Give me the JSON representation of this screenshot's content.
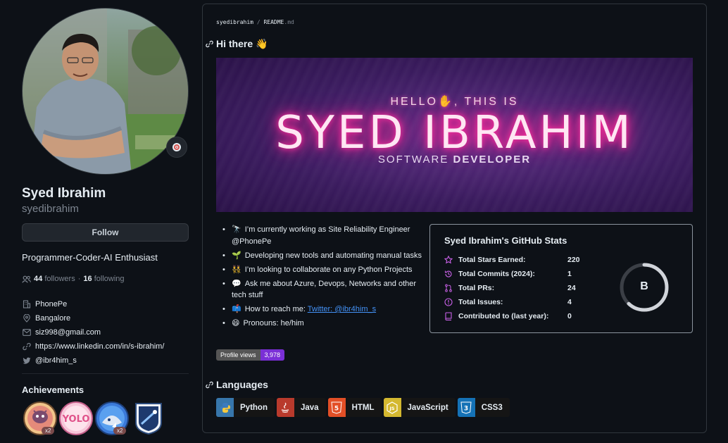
{
  "profile": {
    "name": "Syed Ibrahim",
    "login": "syedibrahim",
    "follow_label": "Follow",
    "bio": "Programmer-Coder-AI Enthusiast",
    "followers_count": "44",
    "followers_label": "followers",
    "separator": "·",
    "following_count": "16",
    "following_label": "following",
    "vcard": [
      {
        "icon": "organization-icon",
        "text": "PhonePe"
      },
      {
        "icon": "location-icon",
        "text": "Bangalore"
      },
      {
        "icon": "mail-icon",
        "text": "siz998@gmail.com"
      },
      {
        "icon": "link-icon",
        "text": "https://www.linkedin.com/in/s-ibrahim/"
      },
      {
        "icon": "twitter-icon",
        "text": "@ibr4him_s"
      }
    ],
    "achievements_title": "Achievements",
    "achievement_counts": [
      "x2",
      "x2"
    ]
  },
  "readme": {
    "breadcrumb_user": "syedibrahim",
    "breadcrumb_sep": "/",
    "breadcrumb_file": "README",
    "breadcrumb_ext": ".md",
    "heading_hi": "Hi there 👋",
    "banner": {
      "hello": "HELLO✋, THIS IS",
      "name": "SYED IBRAHIM",
      "role_a": "SOFTWARE ",
      "role_b": "DEVELOPER"
    },
    "bullets": [
      {
        "emoji": "🔭",
        "text": "I’m currently working as Site Reliability Engineer @PhonePe"
      },
      {
        "emoji": "🌱",
        "text": "Developing new tools and automating manual tasks"
      },
      {
        "emoji": "👯",
        "text": "I’m looking to collaborate on any Python Projects"
      },
      {
        "emoji": "💬",
        "text": "Ask me about Azure, Devops, Networks and other tech stuff"
      },
      {
        "emoji": "📫",
        "text": "How to reach me: ",
        "link": "Twitter: @ibr4him_s"
      },
      {
        "emoji": "😄",
        "text": "Pronouns: he/him"
      }
    ],
    "profile_views_label": "Profile views",
    "profile_views_value": "3,978",
    "stats": {
      "title": "Syed Ibrahim's GitHub Stats",
      "rows": [
        {
          "icon": "star-icon",
          "label": "Total Stars Earned:",
          "value": "220"
        },
        {
          "icon": "history-icon",
          "label": "Total Commits (2024):",
          "value": "1"
        },
        {
          "icon": "pull-request-icon",
          "label": "Total PRs:",
          "value": "24"
        },
        {
          "icon": "issue-icon",
          "label": "Total Issues:",
          "value": "4"
        },
        {
          "icon": "repo-icon",
          "label": "Contributed to (last year):",
          "value": "0"
        }
      ],
      "rank": "B",
      "rank_progress": 0.62
    },
    "heading_languages": "Languages",
    "languages": [
      {
        "name": "Python",
        "color": "#3776ab"
      },
      {
        "name": "Java",
        "color": "#b93a2c"
      },
      {
        "name": "HTML",
        "color": "#e34f26"
      },
      {
        "name": "JavaScript",
        "color": "#d4b830"
      },
      {
        "name": "CSS3",
        "color": "#1572b6"
      }
    ]
  },
  "colors": {
    "background": "#0d1117",
    "accent_link": "#4493f8",
    "border": "#30363d",
    "stats_accent": "#c961e8"
  }
}
